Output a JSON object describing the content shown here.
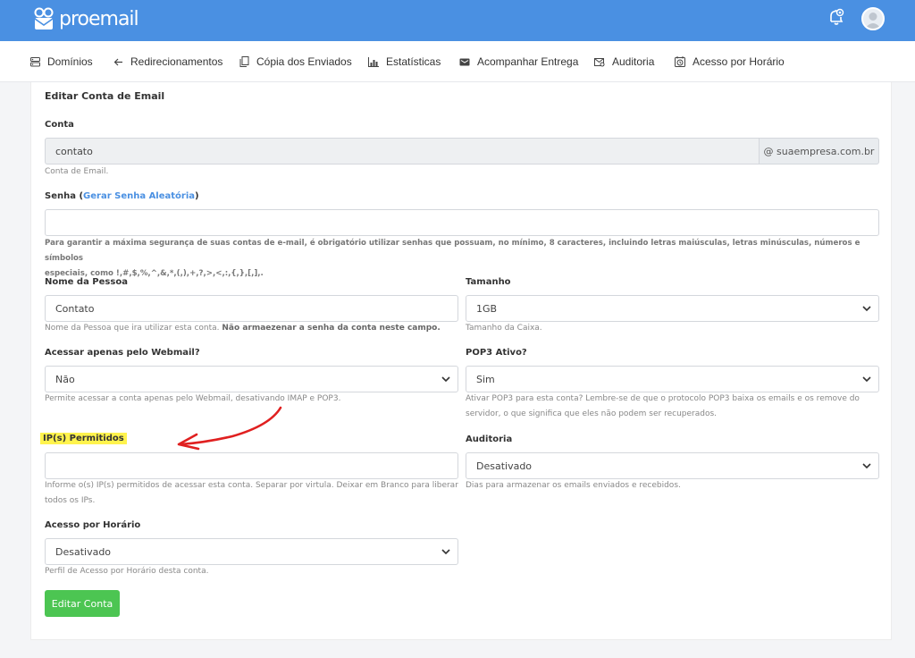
{
  "brand": {
    "name": "proemail"
  },
  "nav": {
    "items": [
      {
        "label": "Domínios",
        "icon": "server-icon"
      },
      {
        "label": "Redirecionamentos",
        "icon": "arrow-left-icon"
      },
      {
        "label": "Cópia dos Enviados",
        "icon": "copy-icon"
      },
      {
        "label": "Estatísticas",
        "icon": "chart-icon"
      },
      {
        "label": "Acompanhar Entrega",
        "icon": "truck-icon"
      },
      {
        "label": "Auditoria",
        "icon": "audit-icon"
      },
      {
        "label": "Acesso por Horário",
        "icon": "clock-icon"
      }
    ]
  },
  "form": {
    "title": "Editar Conta de Email",
    "conta": {
      "label": "Conta",
      "value": "contato",
      "domain": "@ suaempresa.com.br",
      "help": "Conta de Email."
    },
    "senha": {
      "label_prefix": "Senha (",
      "link": "Gerar Senha Aleatória",
      "label_suffix": ")",
      "value": "",
      "help_line1": "Para garantir a máxima segurança de suas contas de e-mail, é obrigatório utilizar senhas que possuam, no mínimo, 8 caracteres, incluindo letras maiúsculas, letras minúsculas, números e símbolos",
      "help_line2": "especiais, como !,#,$,%,^,&,*,(,),+,?,>,<,:,{,},[,],."
    },
    "nome": {
      "label": "Nome da Pessoa",
      "value": "Contato",
      "help_normal": "Nome da Pessoa que ira utilizar esta conta. ",
      "help_bold": "Não armaezenar a senha da conta neste campo."
    },
    "tamanho": {
      "label": "Tamanho",
      "value": "1GB",
      "help": "Tamanho da Caixa."
    },
    "webmail": {
      "label": "Acessar apenas pelo Webmail?",
      "value": "Não",
      "help": "Permite acessar a conta apenas pelo Webmail, desativando IMAP e POP3."
    },
    "pop3": {
      "label": "POP3 Ativo?",
      "value": "Sim",
      "help_line1": "Ativar POP3 para esta conta? Lembre-se de que o protocolo POP3 baixa os emails e os remove do",
      "help_line2": "servidor, o que significa que eles não podem ser recuperados."
    },
    "ips": {
      "label": "IP(s) Permitidos",
      "value": "",
      "help_line1": "Informe o(s) IP(s) permitidos de acessar esta conta. Separar por virtula. Deixar em Branco para liberar",
      "help_line2": "todos os IPs."
    },
    "auditoria": {
      "label": "Auditoria",
      "value": "Desativado",
      "help": "Dias para armazenar os emails enviados e recebidos."
    },
    "horario": {
      "label": "Acesso por Horário",
      "value": "Desativado",
      "help": "Perfil de Acesso por Horário desta conta."
    },
    "submit_label": "Editar Conta"
  },
  "colors": {
    "topbar": "#4a90e2",
    "button": "#4cc552",
    "highlight": "#fff34d",
    "annotation": "#e02020"
  }
}
